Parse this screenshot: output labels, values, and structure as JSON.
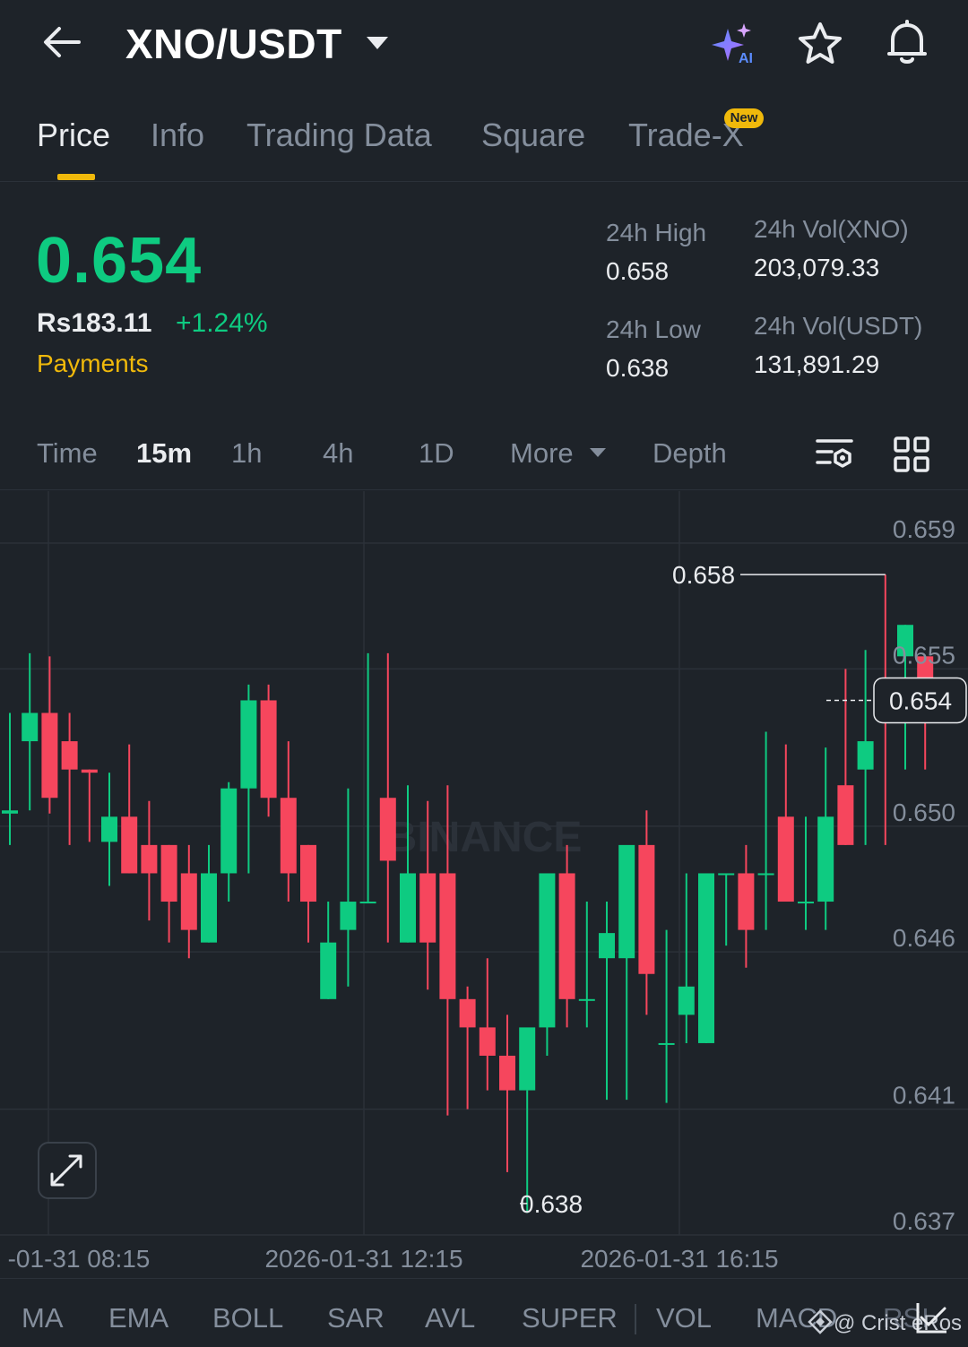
{
  "header": {
    "pair": "XNO/USDT",
    "icons": [
      "back-arrow-icon",
      "caret-down-icon",
      "ai-sparkle-icon",
      "star-icon",
      "bell-icon"
    ],
    "ai_label": "AI"
  },
  "tabs": [
    {
      "label": "Price",
      "active": true
    },
    {
      "label": "Info"
    },
    {
      "label": "Trading Data"
    },
    {
      "label": "Square"
    },
    {
      "label": "Trade-X",
      "badge": "New"
    }
  ],
  "price": {
    "last": "0.654",
    "fiat": "Rs183.11",
    "change": "+1.24%",
    "tag": "Payments"
  },
  "stats": {
    "high_label": "24h High",
    "high_value": "0.658",
    "low_label": "24h Low",
    "low_value": "0.638",
    "vol_base_label": "24h Vol(XNO)",
    "vol_base_value": "203,079.33",
    "vol_quote_label": "24h Vol(USDT)",
    "vol_quote_value": "131,891.29"
  },
  "intervals": [
    "Time",
    "15m",
    "1h",
    "4h",
    "1D",
    "More",
    "Depth"
  ],
  "active_interval": "15m",
  "chart_data": {
    "type": "candlestick",
    "watermark": "BINANCE",
    "y_ticks": [
      "0.659",
      "0.655",
      "0.650",
      "0.646",
      "0.641",
      "0.637"
    ],
    "x_ticks": [
      "-01-31 08:15",
      "2026-01-31 12:15",
      "2026-01-31 16:15"
    ],
    "max_label": "0.658",
    "min_label": "0.638",
    "current_label": "0.654",
    "colors": {
      "up": "#0ecb81",
      "down": "#f6465d",
      "grid": "#2b3139",
      "axis_text": "#848e9c"
    },
    "candles": [
      {
        "o": 0.6504,
        "h": 0.6536,
        "l": 0.6494,
        "c": 0.6505
      },
      {
        "o": 0.6527,
        "h": 0.6555,
        "l": 0.6505,
        "c": 0.6536
      },
      {
        "o": 0.6536,
        "h": 0.6554,
        "l": 0.6504,
        "c": 0.6509
      },
      {
        "o": 0.6527,
        "h": 0.6536,
        "l": 0.6494,
        "c": 0.6518
      },
      {
        "o": 0.6518,
        "h": 0.6518,
        "l": 0.6495,
        "c": 0.6517
      },
      {
        "o": 0.6495,
        "h": 0.6517,
        "l": 0.6481,
        "c": 0.6503
      },
      {
        "o": 0.6503,
        "h": 0.6526,
        "l": 0.6485,
        "c": 0.6485
      },
      {
        "o": 0.6494,
        "h": 0.6508,
        "l": 0.647,
        "c": 0.6485
      },
      {
        "o": 0.6494,
        "h": 0.6494,
        "l": 0.6463,
        "c": 0.6476
      },
      {
        "o": 0.6485,
        "h": 0.6494,
        "l": 0.6458,
        "c": 0.6467
      },
      {
        "o": 0.6463,
        "h": 0.6494,
        "l": 0.6463,
        "c": 0.6485
      },
      {
        "o": 0.6485,
        "h": 0.6514,
        "l": 0.6476,
        "c": 0.6512
      },
      {
        "o": 0.6512,
        "h": 0.6545,
        "l": 0.6485,
        "c": 0.654
      },
      {
        "o": 0.654,
        "h": 0.6545,
        "l": 0.6503,
        "c": 0.6509
      },
      {
        "o": 0.6509,
        "h": 0.6527,
        "l": 0.6476,
        "c": 0.6485
      },
      {
        "o": 0.6494,
        "h": 0.6494,
        "l": 0.6463,
        "c": 0.6476
      },
      {
        "o": 0.6445,
        "h": 0.6476,
        "l": 0.6445,
        "c": 0.6463
      },
      {
        "o": 0.6467,
        "h": 0.6512,
        "l": 0.6449,
        "c": 0.6476
      },
      {
        "o": 0.6476,
        "h": 0.6555,
        "l": 0.6476,
        "c": 0.6476
      },
      {
        "o": 0.6509,
        "h": 0.6555,
        "l": 0.6463,
        "c": 0.6489
      },
      {
        "o": 0.6463,
        "h": 0.6513,
        "l": 0.6463,
        "c": 0.6485
      },
      {
        "o": 0.6485,
        "h": 0.6508,
        "l": 0.6448,
        "c": 0.6463
      },
      {
        "o": 0.6485,
        "h": 0.6513,
        "l": 0.6408,
        "c": 0.6445
      },
      {
        "o": 0.6445,
        "h": 0.6449,
        "l": 0.641,
        "c": 0.6436
      },
      {
        "o": 0.6436,
        "h": 0.6458,
        "l": 0.6416,
        "c": 0.6427
      },
      {
        "o": 0.6427,
        "h": 0.644,
        "l": 0.639,
        "c": 0.6416
      },
      {
        "o": 0.6416,
        "h": 0.6416,
        "l": 0.6377,
        "c": 0.6436
      },
      {
        "o": 0.6436,
        "h": 0.6476,
        "l": 0.6427,
        "c": 0.6485
      },
      {
        "o": 0.6485,
        "h": 0.6494,
        "l": 0.6436,
        "c": 0.6445
      },
      {
        "o": 0.6445,
        "h": 0.6476,
        "l": 0.6436,
        "c": 0.6445
      },
      {
        "o": 0.6458,
        "h": 0.6476,
        "l": 0.6413,
        "c": 0.6466
      },
      {
        "o": 0.6458,
        "h": 0.6476,
        "l": 0.6413,
        "c": 0.6494
      },
      {
        "o": 0.6494,
        "h": 0.6505,
        "l": 0.644,
        "c": 0.6453
      },
      {
        "o": 0.6431,
        "h": 0.6467,
        "l": 0.6412,
        "c": 0.6431
      },
      {
        "o": 0.644,
        "h": 0.6485,
        "l": 0.6431,
        "c": 0.6449
      },
      {
        "o": 0.6431,
        "h": 0.6485,
        "l": 0.6431,
        "c": 0.6485
      },
      {
        "o": 0.6485,
        "h": 0.6485,
        "l": 0.6462,
        "c": 0.6485
      },
      {
        "o": 0.6485,
        "h": 0.6494,
        "l": 0.6455,
        "c": 0.6467
      },
      {
        "o": 0.6485,
        "h": 0.653,
        "l": 0.6467,
        "c": 0.6485
      },
      {
        "o": 0.6503,
        "h": 0.6526,
        "l": 0.6476,
        "c": 0.6476
      },
      {
        "o": 0.6476,
        "h": 0.6503,
        "l": 0.6467,
        "c": 0.6476
      },
      {
        "o": 0.6476,
        "h": 0.6525,
        "l": 0.6467,
        "c": 0.6503
      },
      {
        "o": 0.6513,
        "h": 0.655,
        "l": 0.6494,
        "c": 0.6494
      },
      {
        "o": 0.6518,
        "h": 0.6556,
        "l": 0.6494,
        "c": 0.6527
      },
      {
        "o": 0.6545,
        "h": 0.658,
        "l": 0.6494,
        "c": 0.6536
      },
      {
        "o": 0.6554,
        "h": 0.6564,
        "l": 0.6518,
        "c": 0.6564
      },
      {
        "o": 0.6554,
        "h": 0.6554,
        "l": 0.6518,
        "c": 0.654
      }
    ]
  },
  "indicators": [
    "MA",
    "EMA",
    "BOLL",
    "SAR",
    "AVL",
    "SUPER",
    "VOL",
    "MACD",
    "RSI"
  ],
  "watermark": {
    "text": "@ Crist eRos"
  }
}
